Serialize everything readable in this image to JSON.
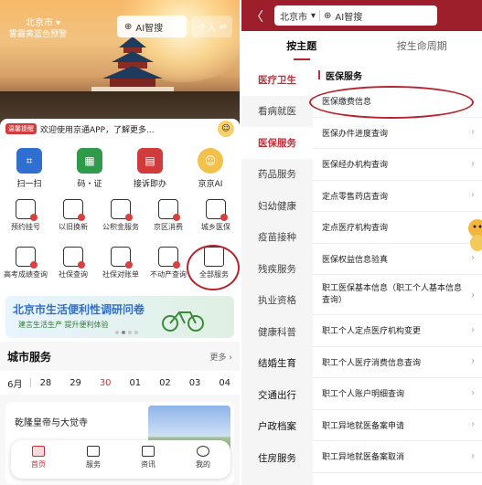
{
  "left": {
    "hero": {
      "city": "北京市",
      "weather": "雾霾黄蓝色预警",
      "ai_label": "AI智搜",
      "person_label": "个人"
    },
    "notice": {
      "tag": "温馨提醒",
      "text": "欢迎使用京通APP，了解更多..."
    },
    "top_services": [
      {
        "label": "扫一扫",
        "icon": "scan-icon",
        "color": "#2f6fcf"
      },
      {
        "label": "码・证",
        "icon": "qr-icon",
        "color": "#2f9a4a"
      },
      {
        "label": "接诉即办",
        "icon": "message-icon",
        "color": "#d23b3b"
      },
      {
        "label": "京京AI",
        "icon": "mascot-icon",
        "color": "#f2c14a"
      }
    ],
    "grid_row1": [
      {
        "label": "预约挂号",
        "icon": "calendar-icon"
      },
      {
        "label": "以旧换新",
        "icon": "exchange-icon"
      },
      {
        "label": "公积金服务",
        "icon": "house-fund-icon"
      },
      {
        "label": "京区消费",
        "icon": "document-icon"
      },
      {
        "label": "城乡医保",
        "icon": "medical-icon"
      }
    ],
    "grid_row2": [
      {
        "label": "高考成绩查询",
        "icon": "exam-icon"
      },
      {
        "label": "社保查询",
        "icon": "doc-search-icon"
      },
      {
        "label": "社保对账单",
        "icon": "statement-icon"
      },
      {
        "label": "不动产查询",
        "icon": "property-icon"
      },
      {
        "label": "全部服务",
        "icon": "grid-icon"
      }
    ],
    "banner": {
      "title": "北京市生活便利性调研问卷",
      "subtitle": "建言生活生产 提升便利体验"
    },
    "city_services": {
      "title": "城市服务",
      "more": "更多",
      "dates": [
        "6月",
        "28",
        "29",
        "30",
        "01",
        "02",
        "03",
        "04"
      ],
      "news_title": "乾隆皇帝与大觉寺"
    },
    "tabbar": [
      {
        "label": "首页"
      },
      {
        "label": "服务"
      },
      {
        "label": "资讯"
      },
      {
        "label": "我的"
      }
    ]
  },
  "right": {
    "header": {
      "back": "〈",
      "city": "北京市",
      "ai_label": "AI智搜"
    },
    "tabs": [
      "按主题",
      "按生命周期"
    ],
    "categories": [
      "医疗卫生",
      "看病就医",
      "医保服务",
      "药品服务",
      "妇幼健康",
      "疫苗接种",
      "残疾服务",
      "执业资格",
      "健康科普",
      "结婚生育",
      "交通出行",
      "户政档案",
      "住房服务"
    ],
    "section_title": "医保服务",
    "items": [
      "医保缴费信息",
      "医保办件进度查询",
      "医保经办机构查询",
      "定点零售药店查询",
      "定点医疗机构查询",
      "医保权益信息验真",
      "职工医保基本信息（职工个人基本信息查询）",
      "职工个人定点医疗机构变更",
      "职工个人医疗消费信息查询",
      "职工个人账户明细查询",
      "职工异地就医备案申请",
      "职工异地就医备案取消"
    ]
  }
}
